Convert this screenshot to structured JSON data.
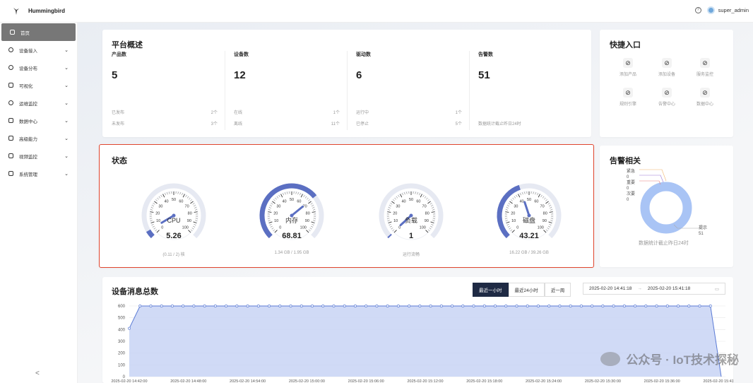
{
  "app": {
    "name": "Hummingbird",
    "user": "super_admin"
  },
  "sidebar": {
    "items": [
      {
        "label": "首页",
        "icon": "home-icon"
      },
      {
        "label": "设备接入",
        "icon": "globe-icon"
      },
      {
        "label": "设备分布",
        "icon": "eye-icon"
      },
      {
        "label": "可视化",
        "icon": "monitor-icon"
      },
      {
        "label": "运维监控",
        "icon": "clock-icon"
      },
      {
        "label": "数据中心",
        "icon": "database-icon"
      },
      {
        "label": "高级能力",
        "icon": "flask-icon"
      },
      {
        "label": "视频监控",
        "icon": "video-icon"
      },
      {
        "label": "系统管理",
        "icon": "desktop-icon"
      }
    ],
    "collapse_label": "<"
  },
  "overview": {
    "title": "平台概述",
    "stats": [
      {
        "label": "产品数",
        "value": "5",
        "rows": [
          [
            "已发布",
            "2个"
          ],
          [
            "未发布",
            "3个"
          ]
        ]
      },
      {
        "label": "设备数",
        "value": "12",
        "rows": [
          [
            "在线",
            "1个"
          ],
          [
            "离线",
            "11个"
          ]
        ]
      },
      {
        "label": "驱动数",
        "value": "6",
        "rows": [
          [
            "运行中",
            "1个"
          ],
          [
            "已停止",
            "5个"
          ]
        ]
      },
      {
        "label": "告警数",
        "value": "51",
        "note": "数据统计截止昨日24时"
      }
    ]
  },
  "quick": {
    "title": "快捷入口",
    "items": [
      "添加产品",
      "添加设备",
      "服务监控",
      "规则引擎",
      "告警中心",
      "数据中心"
    ]
  },
  "status": {
    "title": "状态",
    "gauges": [
      {
        "name": "CPU",
        "value": 5.26,
        "display": "5.26",
        "sub": "(0.11 / 2) 核"
      },
      {
        "name": "内存",
        "value": 68.81,
        "display": "68.81",
        "sub": "1.34 GB / 1.95 GB"
      },
      {
        "name": "负载",
        "value": 1,
        "display": "1",
        "sub": "运行流畅"
      },
      {
        "name": "磁盘",
        "value": 43.21,
        "display": "43.21",
        "sub": "16.22 GB / 39.26 GB"
      }
    ],
    "ticks": [
      "0",
      "10",
      "20",
      "30",
      "40",
      "50",
      "60",
      "70",
      "80",
      "90",
      "100"
    ]
  },
  "alarm": {
    "title": "告警相关",
    "legend": [
      {
        "label": "紧急",
        "value": "0"
      },
      {
        "label": "重要",
        "value": "0"
      },
      {
        "label": "次要",
        "value": "0"
      },
      {
        "label": "提示",
        "value": "51"
      }
    ],
    "note": "数据统计截止昨日24时",
    "colors": {
      "ring": "#a9c4f5"
    }
  },
  "messages": {
    "title": "设备消息总数",
    "buttons": [
      "最近一小时",
      "最近24小时",
      "近一周"
    ],
    "range_start": "2025-02-20 14:41:18",
    "range_sep": "→",
    "range_end": "2025-02-20 15:41:18"
  },
  "chart_data": {
    "type": "area",
    "ylim": [
      0,
      600
    ],
    "yticks": [
      "0",
      "100",
      "200",
      "300",
      "400",
      "500",
      "600"
    ],
    "x_labels": [
      "2025-02-20 14:42:00",
      "2025-02-20 14:48:00",
      "2025-02-20 14:54:00",
      "2025-02-20 15:00:00",
      "2025-02-20 15:06:00",
      "2025-02-20 15:12:00",
      "2025-02-20 15:18:00",
      "2025-02-20 15:24:00",
      "2025-02-20 15:30:00",
      "2025-02-20 15:36:00",
      "2025-02-20 15:41:18"
    ],
    "values": [
      410,
      600,
      600,
      600,
      600,
      600,
      600,
      600,
      600,
      600,
      600,
      600,
      600,
      600,
      600,
      600,
      600,
      600,
      600,
      600,
      600,
      600,
      600,
      600,
      600,
      600,
      600,
      600,
      600,
      600,
      600,
      600,
      600,
      600,
      600,
      600,
      600,
      600,
      600,
      600,
      600,
      600,
      600,
      600,
      600,
      600,
      600,
      600,
      600,
      600,
      600,
      600,
      600,
      600,
      600,
      0
    ],
    "grid": true,
    "color": "#5b7bd5"
  },
  "watermark": "公众号 · IoT技术探秘"
}
